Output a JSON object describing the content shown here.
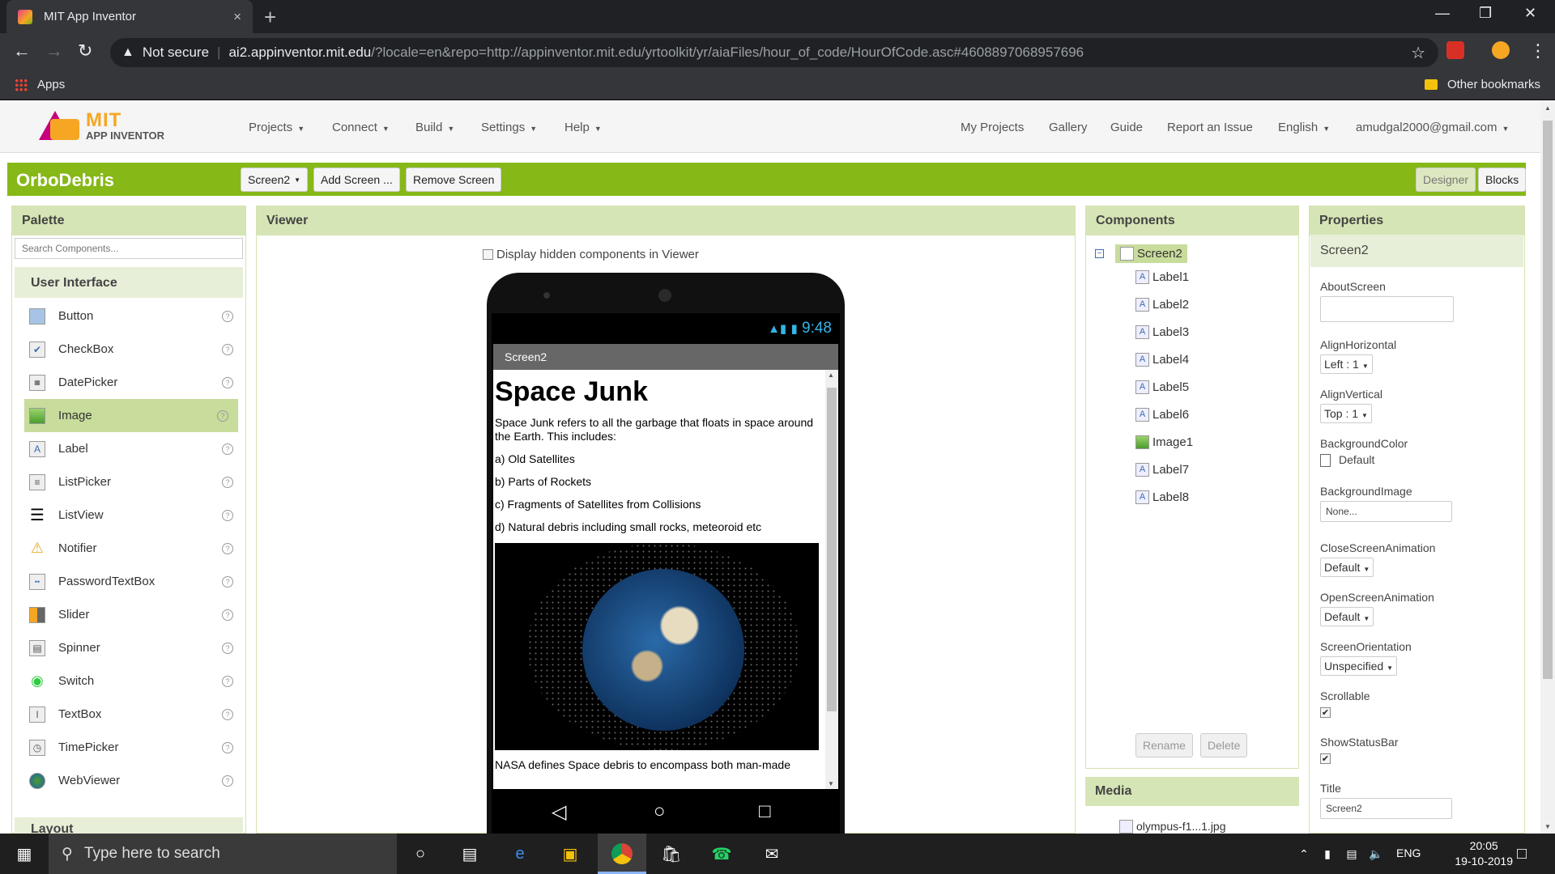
{
  "browser": {
    "tab_title": "MIT App Inventor",
    "tab_close": "×",
    "new_tab": "+",
    "not_secure": "Not secure",
    "url_host": "ai2.appinventor.mit.edu",
    "url_path": "/?locale=en&repo=http://appinventor.mit.edu/yrtoolkit/yr/aiaFiles/hour_of_code/HourOfCode.asc#4608897068957696",
    "bookmark_apps": "Apps",
    "bookmark_other": "Other bookmarks"
  },
  "header": {
    "logo_mit": "MIT",
    "logo_ai": "APP INVENTOR",
    "menus": [
      "Projects",
      "Connect",
      "Build",
      "Settings",
      "Help"
    ],
    "right_links": [
      "My Projects",
      "Gallery",
      "Guide",
      "Report an Issue"
    ],
    "language": "English",
    "account": "amudgal2000@gmail.com"
  },
  "toolbar": {
    "project_name": "OrboDebris",
    "screen_select": "Screen2",
    "add_screen": "Add Screen ...",
    "remove_screen": "Remove Screen",
    "designer": "Designer",
    "blocks": "Blocks"
  },
  "palette": {
    "title": "Palette",
    "search_placeholder": "Search Components...",
    "category": "User Interface",
    "items": [
      "Button",
      "CheckBox",
      "DatePicker",
      "Image",
      "Label",
      "ListPicker",
      "ListView",
      "Notifier",
      "PasswordTextBox",
      "Slider",
      "Spinner",
      "Switch",
      "TextBox",
      "TimePicker",
      "WebViewer"
    ],
    "selected": "Image",
    "next_category": "Layout"
  },
  "viewer": {
    "title": "Viewer",
    "hidden_label": "Display hidden components in Viewer",
    "status_time": "9:48",
    "screen_title": "Screen2",
    "content_title": "Space Junk",
    "intro": "Space Junk refers to all the garbage that floats in space around the Earth. This includes:",
    "items": [
      "a) Old Satellites",
      "b) Parts of Rockets",
      "c) Fragments of Satellites from Collisions",
      "d) Natural debris including small rocks, meteoroid etc"
    ],
    "footer_text": "NASA defines Space debris to encompass both man-made"
  },
  "components": {
    "title": "Components",
    "root": "Screen2",
    "children": [
      {
        "name": "Label1",
        "type": "label"
      },
      {
        "name": "Label2",
        "type": "label"
      },
      {
        "name": "Label3",
        "type": "label"
      },
      {
        "name": "Label4",
        "type": "label"
      },
      {
        "name": "Label5",
        "type": "label"
      },
      {
        "name": "Label6",
        "type": "label"
      },
      {
        "name": "Image1",
        "type": "image"
      },
      {
        "name": "Label7",
        "type": "label"
      },
      {
        "name": "Label8",
        "type": "label"
      }
    ],
    "rename": "Rename",
    "delete": "Delete",
    "media_title": "Media",
    "media_item": "olympus-f1...1.jpg"
  },
  "properties": {
    "title": "Properties",
    "component": "Screen2",
    "about_label": "AboutScreen",
    "align_h_label": "AlignHorizontal",
    "align_h_value": "Left : 1",
    "align_v_label": "AlignVertical",
    "align_v_value": "Top : 1",
    "bgcolor_label": "BackgroundColor",
    "bgcolor_value": "Default",
    "bgimage_label": "BackgroundImage",
    "bgimage_value": "None...",
    "close_anim_label": "CloseScreenAnimation",
    "close_anim_value": "Default",
    "open_anim_label": "OpenScreenAnimation",
    "open_anim_value": "Default",
    "orientation_label": "ScreenOrientation",
    "orientation_value": "Unspecified",
    "scrollable_label": "Scrollable",
    "statusbar_label": "ShowStatusBar",
    "title_label": "Title",
    "title_value": "Screen2"
  },
  "taskbar": {
    "search_placeholder": "Type here to search",
    "lang": "ENG",
    "time": "20:05",
    "date": "19-10-2019"
  }
}
